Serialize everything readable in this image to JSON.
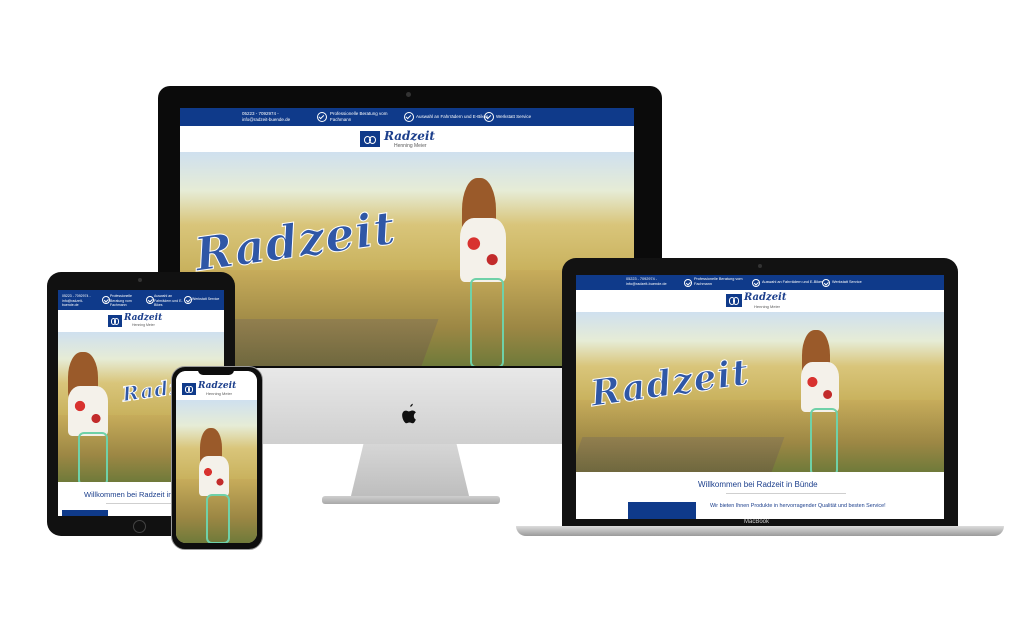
{
  "site": {
    "contact": "05223 - 7092974 - info@radzeit-buende.de",
    "features": [
      "Professionelle Beratung vom Fachmann",
      "Auswahl an Fahrrädern und E-Bikes",
      "Werkstatt Service"
    ],
    "logo_name": "Radzeit",
    "logo_subtitle": "Henning Meier",
    "hero_text": "Radzeit",
    "welcome": "Willkommen bei Radzeit in Bünde",
    "tagline": "Wir bieten Ihnen Produkte in hervorragender Qualität und besten Service!"
  },
  "laptop": {
    "brand": "MacBook"
  },
  "colors": {
    "brand_blue": "#0f3a8a",
    "logo_blue": "#1c3f8c",
    "bike_mint": "#6fd1a8"
  },
  "icons": [
    "check-circle-icon",
    "bicycle-logo-icon",
    "apple-logo-icon"
  ]
}
